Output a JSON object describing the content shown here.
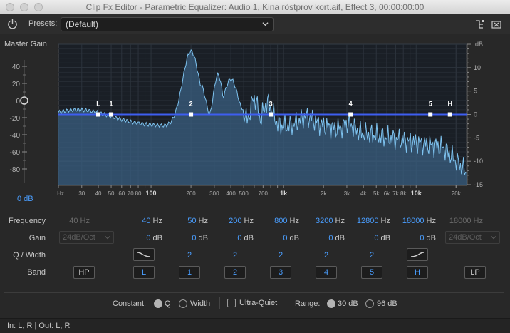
{
  "window": {
    "title": "Clip Fx Editor - Parametric Equalizer: Audio 1, Kina röstprov kort.aif, Effect 3, 00:00:00:00"
  },
  "toolbar": {
    "presets_label": "Presets:",
    "preset_value": "(Default)",
    "icons": [
      "power-icon",
      "chevron-down-icon",
      "routing-icon",
      "close-panel-icon"
    ]
  },
  "master_gain": {
    "label": "Master Gain",
    "value": "0 dB",
    "scale_labels": [
      "40",
      "20",
      "0",
      "-20",
      "-40",
      "-60",
      "-80"
    ],
    "level_db": 0
  },
  "graph": {
    "db_unit": "dB",
    "db_labels": [
      "10",
      "5",
      "0",
      "-5",
      "-10",
      "-15"
    ],
    "freq_labels": [
      "Hz",
      "30",
      "40",
      "50",
      "60",
      "70",
      "80",
      "100",
      "200",
      "300",
      "400",
      "500",
      "700",
      "1k",
      "2k",
      "3k",
      "4k",
      "5k",
      "6k",
      "7k",
      "8k",
      "10k",
      "20k"
    ],
    "freq_values": [
      20,
      30,
      40,
      50,
      60,
      70,
      80,
      100,
      200,
      300,
      400,
      500,
      700,
      1000,
      2000,
      3000,
      4000,
      5000,
      6000,
      7000,
      8000,
      10000,
      20000
    ],
    "db_values": [
      10,
      5,
      0,
      -5,
      -10,
      -15
    ],
    "handles": [
      {
        "label": "L",
        "freq": 40
      },
      {
        "label": "1",
        "freq": 50
      },
      {
        "label": "2",
        "freq": 200
      },
      {
        "label": "3",
        "freq": 800
      },
      {
        "label": "4",
        "freq": 3200
      },
      {
        "label": "5",
        "freq": 12800
      },
      {
        "label": "H",
        "freq": 18000
      }
    ]
  },
  "params": {
    "row_labels": {
      "frequency": "Frequency",
      "gain": "Gain",
      "q_width": "Q / Width",
      "band": "Band"
    },
    "hp": {
      "freq_value": "40",
      "freq_unit": "Hz",
      "slope": "24dB/Oct",
      "band": "HP"
    },
    "lp": {
      "freq_value": "18000",
      "freq_unit": "Hz",
      "slope": "24dB/Oct",
      "band": "LP"
    },
    "bands": [
      {
        "freq": "40",
        "unit": "Hz",
        "gain": "0",
        "gain_unit": "dB",
        "q": "",
        "band": "L",
        "shape_icon": "low-shelf-icon"
      },
      {
        "freq": "50",
        "unit": "Hz",
        "gain": "0",
        "gain_unit": "dB",
        "q": "2",
        "band": "1"
      },
      {
        "freq": "200",
        "unit": "Hz",
        "gain": "0",
        "gain_unit": "dB",
        "q": "2",
        "band": "2"
      },
      {
        "freq": "800",
        "unit": "Hz",
        "gain": "0",
        "gain_unit": "dB",
        "q": "2",
        "band": "3"
      },
      {
        "freq": "3200",
        "unit": "Hz",
        "gain": "0",
        "gain_unit": "dB",
        "q": "2",
        "band": "4"
      },
      {
        "freq": "12800",
        "unit": "Hz",
        "gain": "0",
        "gain_unit": "dB",
        "q": "2",
        "band": "5"
      },
      {
        "freq": "18000",
        "unit": "Hz",
        "gain": "0",
        "gain_unit": "dB",
        "q": "",
        "band": "H",
        "shape_icon": "high-shelf-icon"
      }
    ]
  },
  "constant": {
    "label": "Constant:",
    "q_label": "Q",
    "width_label": "Width",
    "selected": "Q",
    "ultra_quiet_label": "Ultra-Quiet",
    "ultra_quiet_checked": false,
    "range_label": "Range:",
    "range_30": "30 dB",
    "range_96": "96 dB",
    "range_selected": "30 dB"
  },
  "status": {
    "io": "In: L, R | Out: L, R"
  },
  "colors": {
    "accent": "#4a9eff",
    "curve": "#3e5ef0",
    "spectrum_fill": "#3a5f80",
    "spectrum_line": "#7ec3f0"
  }
}
